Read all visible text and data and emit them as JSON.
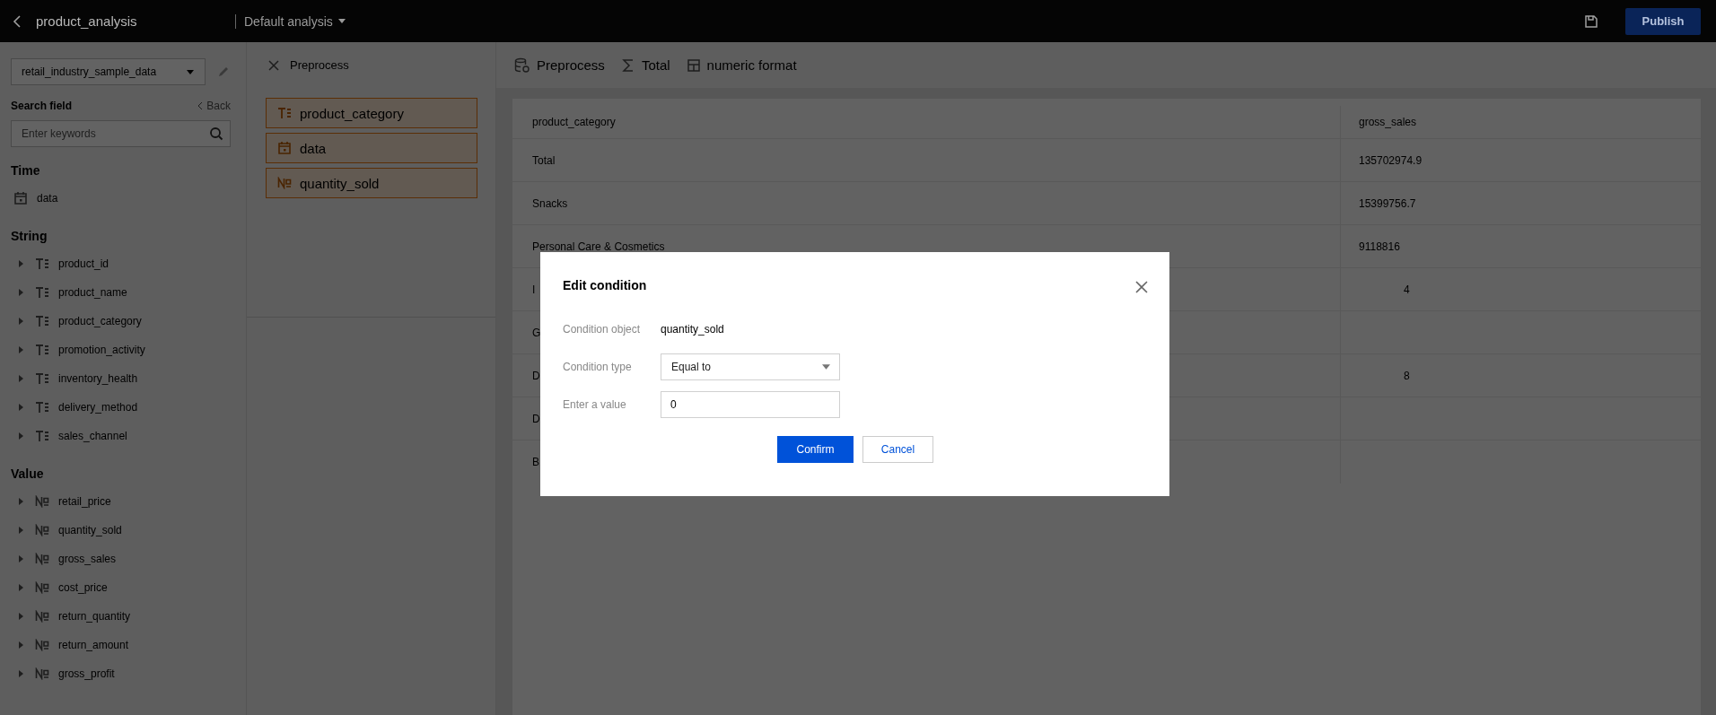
{
  "top_bar": {
    "title": "product_analysis",
    "analysis_menu": "Default analysis",
    "publish": "Publish"
  },
  "sidebar": {
    "dataset": "retail_industry_sample_data",
    "search_title": "Search field",
    "back": "Back",
    "search_placeholder": "Enter keywords",
    "groups": [
      {
        "title": "Time",
        "fields": [
          {
            "name": "data",
            "kind": "date"
          }
        ]
      },
      {
        "title": "String",
        "fields": [
          {
            "name": "product_id",
            "kind": "string"
          },
          {
            "name": "product_name",
            "kind": "string"
          },
          {
            "name": "product_category",
            "kind": "string"
          },
          {
            "name": "promotion_activity",
            "kind": "string"
          },
          {
            "name": "inventory_health",
            "kind": "string"
          },
          {
            "name": "delivery_method",
            "kind": "string"
          },
          {
            "name": "sales_channel",
            "kind": "string"
          }
        ]
      },
      {
        "title": "Value",
        "fields": [
          {
            "name": "retail_price",
            "kind": "number"
          },
          {
            "name": "quantity_sold",
            "kind": "number"
          },
          {
            "name": "gross_sales",
            "kind": "number"
          },
          {
            "name": "cost_price",
            "kind": "number"
          },
          {
            "name": "return_quantity",
            "kind": "number"
          },
          {
            "name": "return_amount",
            "kind": "number"
          },
          {
            "name": "gross_profit",
            "kind": "number"
          }
        ]
      }
    ]
  },
  "preprocess_panel": {
    "title": "Preprocess",
    "fields": [
      {
        "name": "product_category",
        "kind": "string"
      },
      {
        "name": "data",
        "kind": "date"
      },
      {
        "name": "quantity_sold",
        "kind": "number"
      }
    ]
  },
  "toolbar": [
    {
      "label": "Preprocess",
      "kind": "preprocess"
    },
    {
      "label": "Total",
      "kind": "total"
    },
    {
      "label": "numeric format",
      "kind": "format"
    }
  ],
  "table": {
    "columns": [
      "product_category",
      "gross_sales"
    ],
    "rows": [
      [
        "Total",
        "135702974.9"
      ],
      [
        "Snacks",
        "15399756.7"
      ],
      [
        "Personal Care & Cosmetics",
        "9118816"
      ],
      [
        "I",
        "4"
      ],
      [
        "G",
        ""
      ],
      [
        "D",
        "8"
      ],
      [
        "D",
        ""
      ],
      [
        "B",
        ""
      ]
    ]
  },
  "dialog": {
    "title": "Edit condition",
    "fields": [
      {
        "label": "Condition object",
        "value": "quantity_sold",
        "kind": "text"
      },
      {
        "label": "Condition type",
        "value": "Equal to",
        "kind": "select"
      },
      {
        "label": "Enter a value",
        "value": "0",
        "kind": "input"
      }
    ],
    "confirm": "Confirm",
    "cancel": "Cancel"
  }
}
